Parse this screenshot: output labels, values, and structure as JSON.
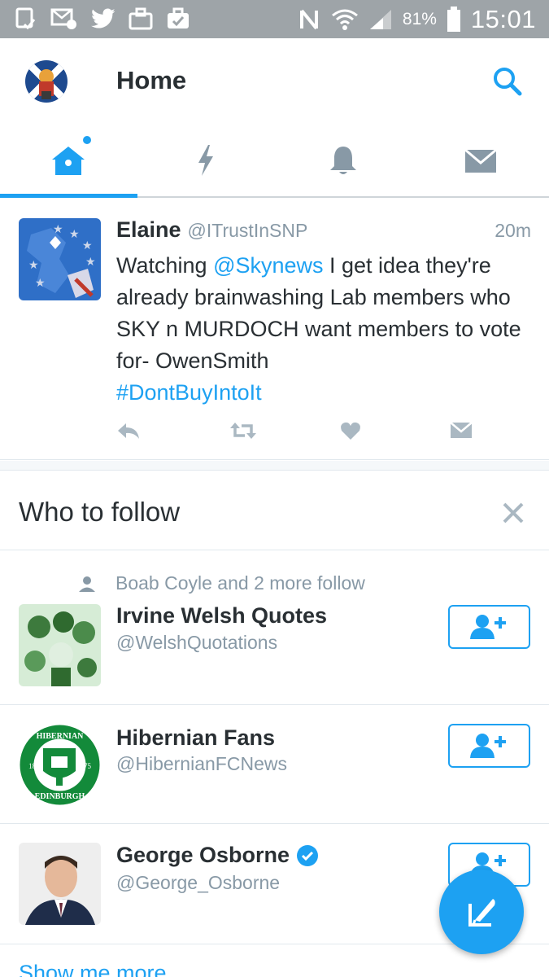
{
  "status_bar": {
    "battery_percent": "81%",
    "time": "15:01",
    "icons": [
      "screenshot-icon",
      "email-notify-icon",
      "twitter-icon",
      "media-icon",
      "briefcase-icon",
      "nfc-icon",
      "wifi-icon",
      "signal-icon",
      "battery-icon"
    ]
  },
  "header": {
    "title": "Home",
    "search_icon": "search-icon"
  },
  "tabs": [
    {
      "name": "home",
      "icon": "home-icon",
      "active": true,
      "has_dot": true
    },
    {
      "name": "moments",
      "icon": "lightning-icon",
      "active": false
    },
    {
      "name": "notifications",
      "icon": "bell-icon",
      "active": false
    },
    {
      "name": "messages",
      "icon": "envelope-icon",
      "active": false
    }
  ],
  "tweet": {
    "name": "Elaine",
    "handle": "@ITrustInSNP",
    "time": "20m",
    "text_before": "Watching ",
    "mention": "@Skynews",
    "text_after": " I get idea they're already brainwashing Lab members who SKY n MURDOCH want members to vote for- OwenSmith",
    "hashtag": "#DontBuyIntoIt",
    "actions": [
      "reply-icon",
      "retweet-icon",
      "like-icon",
      "direct-message-icon"
    ]
  },
  "who_to_follow": {
    "title": "Who to follow",
    "close_icon": "close-icon",
    "accounts": [
      {
        "social_context": "Boab Coyle and 2 more follow",
        "name": "Irvine Welsh Quotes",
        "handle": "@WelshQuotations",
        "verified": false
      },
      {
        "name": "Hibernian Fans",
        "handle": "@HibernianFCNews",
        "verified": false
      },
      {
        "name": "George Osborne",
        "handle": "@George_Osborne",
        "verified": true
      }
    ],
    "show_more": "Show me more"
  },
  "colors": {
    "accent": "#1da1f2",
    "status_bar": "#9ea4a8",
    "text": "#292f33",
    "muted": "#8899a6",
    "icon_gray": "#8899a6"
  }
}
